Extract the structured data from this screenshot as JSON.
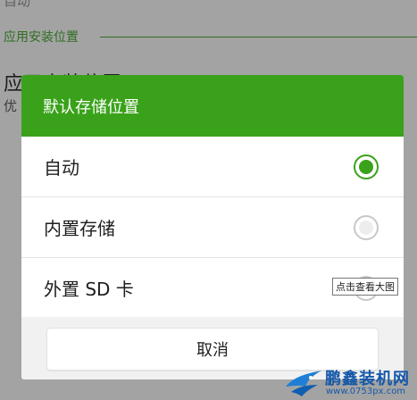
{
  "background": {
    "top_text": "自动",
    "section_label": "应用安装位置",
    "setting_title": "应用安装位置",
    "setting_subtitle": "优"
  },
  "dialog": {
    "title": "默认存储位置",
    "options": [
      {
        "label": "自动",
        "selected": true
      },
      {
        "label": "内置存储",
        "selected": false
      },
      {
        "label": "外置 SD 卡",
        "selected": false
      }
    ],
    "cancel_label": "取消"
  },
  "tooltip": {
    "text": "点击查看大图"
  },
  "watermark": {
    "name": "鹏鑫装机网",
    "url": "www.0753px.com"
  },
  "colors": {
    "accent": "#3aa21a",
    "overlay": "#a3a3a3"
  }
}
